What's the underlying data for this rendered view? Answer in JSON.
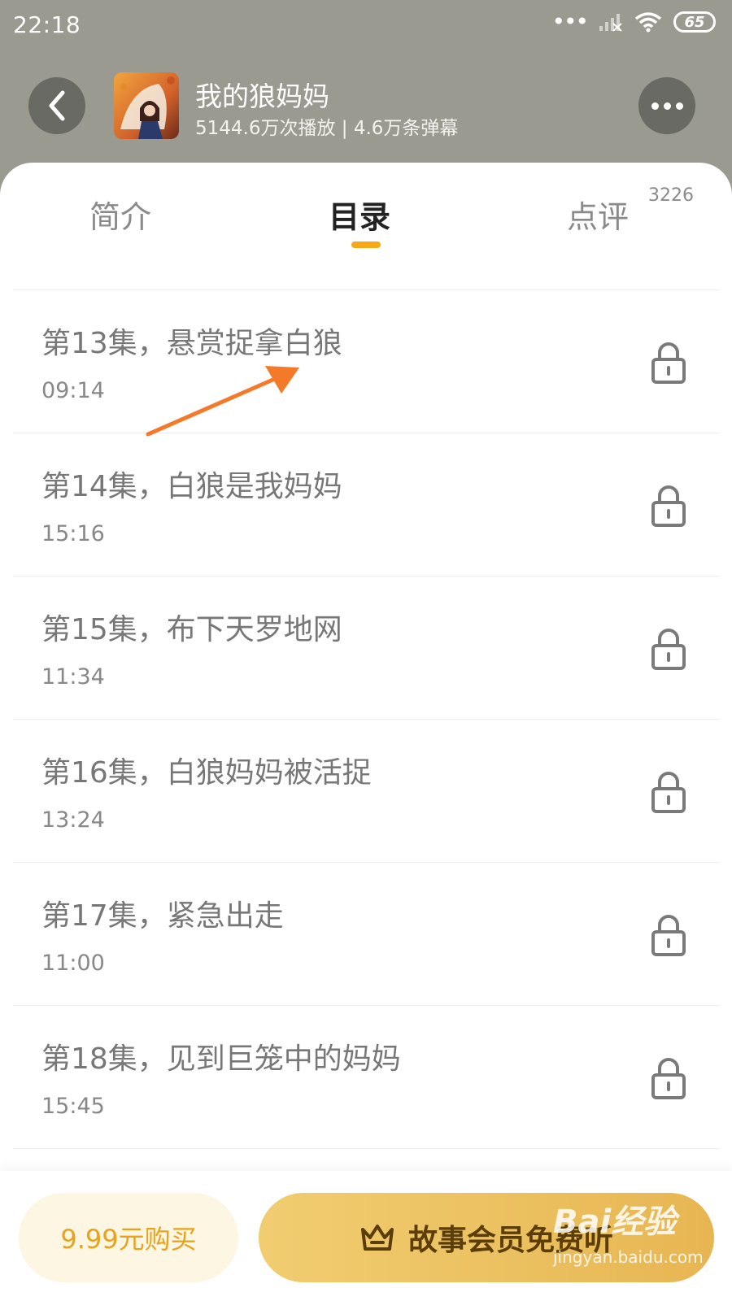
{
  "status_bar": {
    "time": "22:18",
    "battery": "65",
    "icons": [
      "more-dots-icon",
      "signal-icon",
      "wifi-icon",
      "battery-icon"
    ]
  },
  "header": {
    "title": "我的狼妈妈",
    "stats": "5144.6万次播放 | 4.6万条弹幕",
    "back_icon": "chevron-left-icon",
    "more_icon": "more-horizontal-icon"
  },
  "tabs": [
    {
      "label": "简介",
      "active": false
    },
    {
      "label": "目录",
      "active": true
    },
    {
      "label": "点评",
      "active": false,
      "badge": "3226"
    }
  ],
  "episodes": [
    {
      "title": "第13集，悬赏捉拿白狼",
      "duration": "09:14",
      "locked": true
    },
    {
      "title": "第14集，白狼是我妈妈",
      "duration": "15:16",
      "locked": true
    },
    {
      "title": "第15集，布下天罗地网",
      "duration": "11:34",
      "locked": true
    },
    {
      "title": "第16集，白狼妈妈被活捉",
      "duration": "13:24",
      "locked": true
    },
    {
      "title": "第17集，紧急出走",
      "duration": "11:00",
      "locked": true
    },
    {
      "title": "第18集，见到巨笼中的妈妈",
      "duration": "15:45",
      "locked": true
    }
  ],
  "bottom_bar": {
    "buy_label": "9.99元购买",
    "vip_label": "故事会员免费听",
    "vip_icon": "crown-icon"
  },
  "watermark": {
    "main": "Bai经验",
    "sub": "jingyan.baidu.com"
  },
  "colors": {
    "header_bg": "#9b9a91",
    "accent": "#f6a817",
    "vip_gold": "#ecc25f",
    "annotation_arrow": "#f47a2a"
  }
}
